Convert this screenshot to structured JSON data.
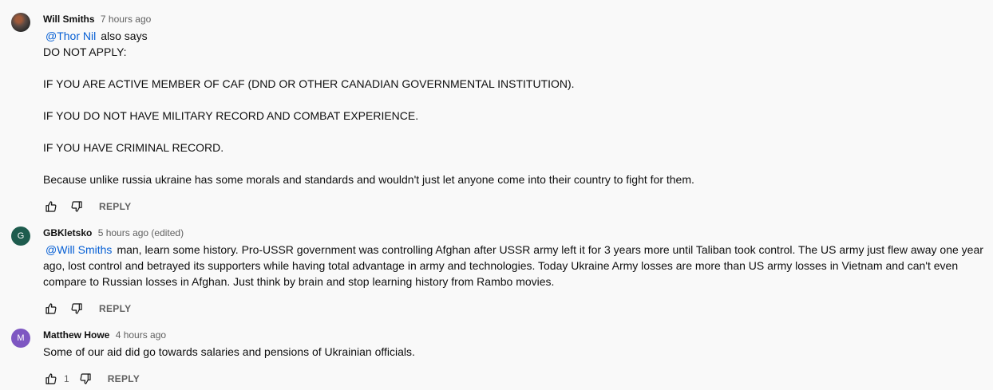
{
  "comments": [
    {
      "author": "Will Smiths",
      "time": "7 hours ago",
      "avatar_type": "photo",
      "mention": "@Thor Nil",
      "lines": [
        "also says",
        "DO NOT APPLY:",
        "",
        "IF YOU ARE ACTIVE MEMBER OF CAF (DND OR OTHER CANADIAN GOVERNMENTAL INSTITUTION).",
        "",
        "IF YOU DO NOT HAVE MILITARY RECORD AND COMBAT EXPERIENCE.",
        "",
        "IF YOU HAVE CRIMINAL RECORD.",
        "",
        "Because unlike russia ukraine has some morals and standards and wouldn't just let anyone come into their country to fight for them."
      ],
      "reply_label": "REPLY"
    },
    {
      "author": "GBKletsko",
      "time": "5 hours ago (edited)",
      "avatar_letter": "G",
      "avatar_color": "#1e5c4e",
      "mention": "@Will Smiths",
      "lines": [
        "man, learn some history. Pro-USSR government was controlling Afghan after USSR army left it for 3 years more until Taliban took control. The US army just flew away one year",
        "ago, lost control and betrayed its supporters while having total advantage in army and technologies. Today Ukraine Army losses are more than US army losses in Vietnam and can't even",
        "compare to Russian losses in Afghan. Just think by brain and stop learning history from Rambo movies."
      ],
      "reply_label": "REPLY"
    },
    {
      "author": "Matthew Howe",
      "time": "4 hours ago",
      "avatar_letter": "M",
      "avatar_color": "#7e57c2",
      "lines": [
        "Some of our aid did go towards salaries and pensions of Ukrainian officials."
      ],
      "like_count": "1",
      "reply_label": "REPLY"
    }
  ],
  "colors": {
    "background": "#f9f9f9",
    "mention": "#065fd4",
    "secondary_text": "#606060"
  },
  "icons": [
    "thumbs-up-icon",
    "thumbs-down-icon"
  ]
}
